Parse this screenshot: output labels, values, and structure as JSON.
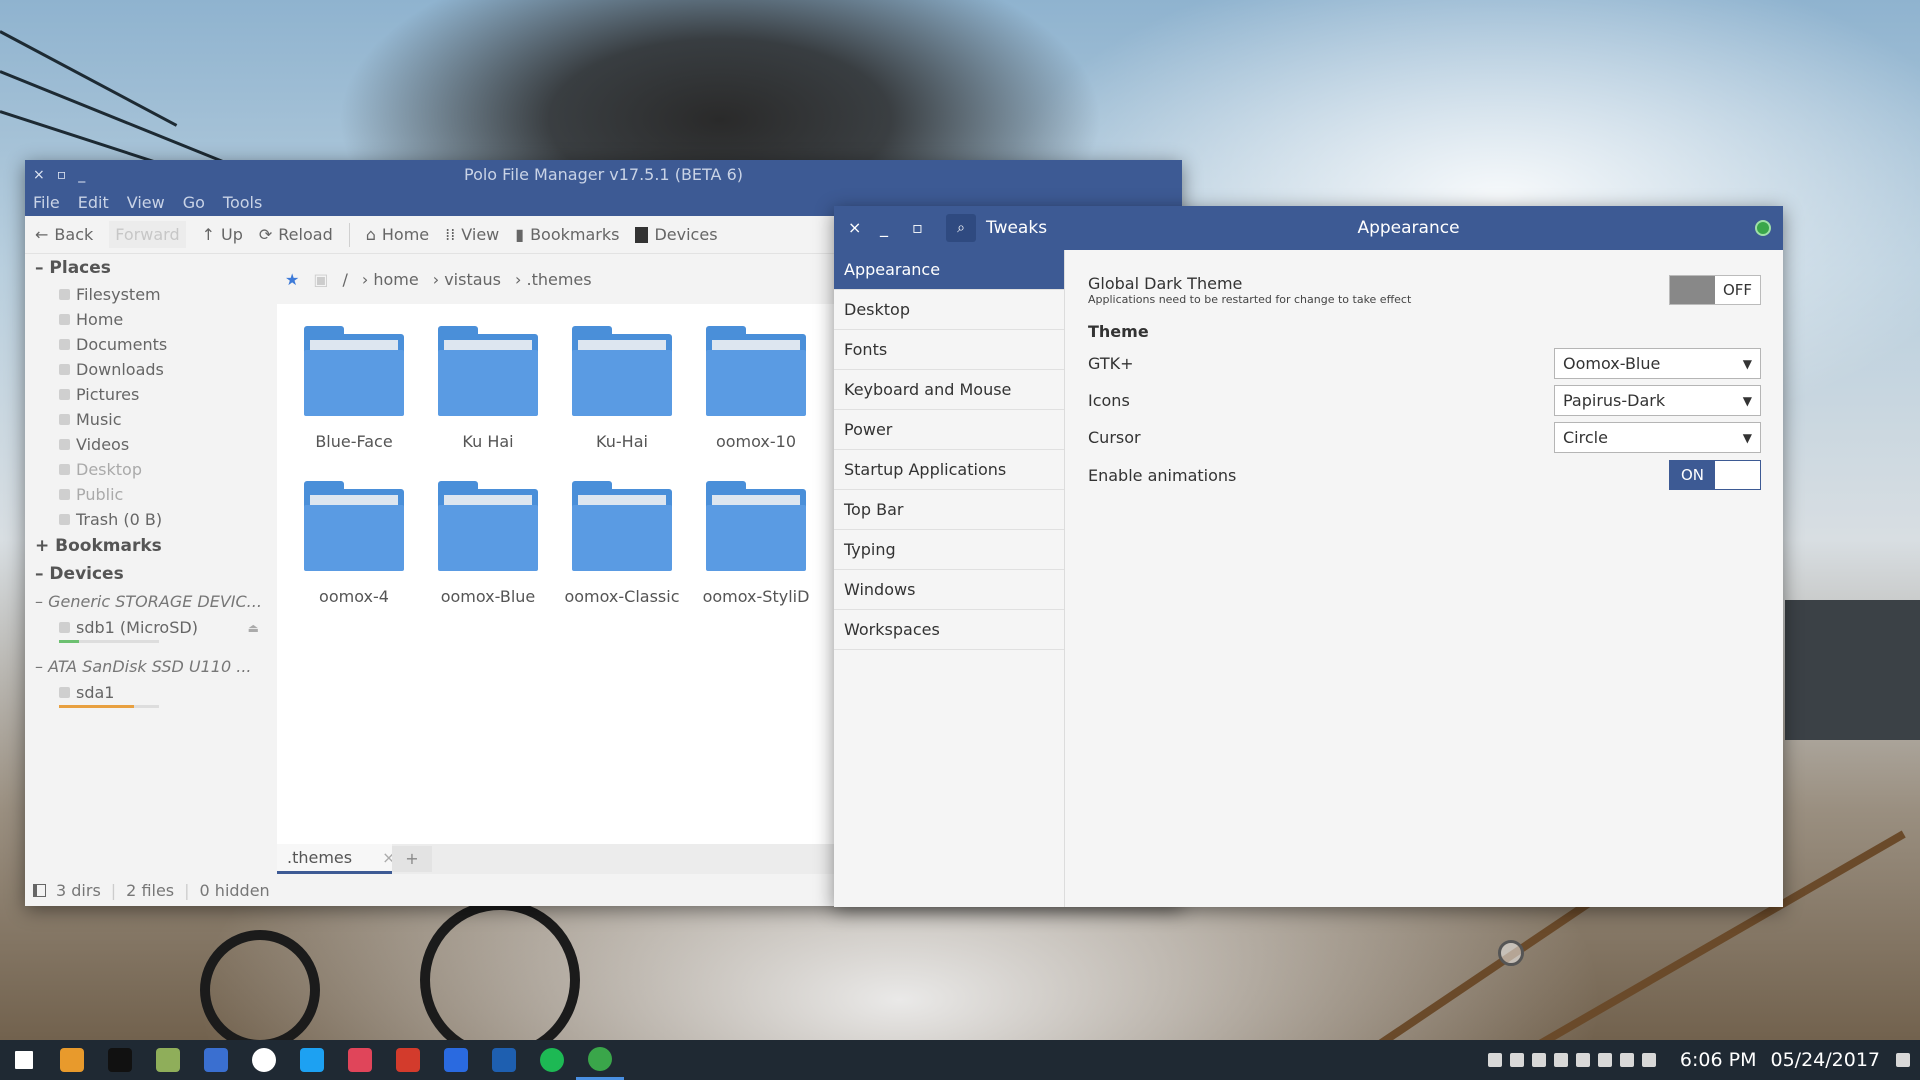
{
  "polo": {
    "title": "Polo File Manager v17.5.1 (BETA 6)",
    "window_buttons": [
      "×",
      "▫",
      "_"
    ],
    "menu": [
      "File",
      "Edit",
      "View",
      "Go",
      "Tools"
    ],
    "toolbar": {
      "back": "Back",
      "forward": "Forward",
      "up": "Up",
      "reload": "Reload",
      "home": "Home",
      "view": "View",
      "bookmarks": "Bookmarks",
      "devices": "Devices"
    },
    "sidebar": {
      "places_header": "Places",
      "places": [
        "Filesystem",
        "Home",
        "Documents",
        "Downloads",
        "Pictures",
        "Music",
        "Videos",
        "Desktop",
        "Public",
        "Trash (0 B)"
      ],
      "bookmarks_header": "Bookmarks",
      "devices_header": "Devices",
      "device1": "Generic STORAGE DEVIC...",
      "device1_part": "sdb1 (MicroSD)",
      "device1_usage": 0.2,
      "device2": "ATA SanDisk SSD U110 ...",
      "device2_part": "sda1",
      "device2_usage": 0.75
    },
    "breadcrumb": [
      "/",
      "home",
      "vistaus",
      ".themes"
    ],
    "items": [
      "Blue-Face",
      "Ku Hai",
      "Ku-Hai",
      "oomox-10",
      "oomox-4",
      "oomox-Blue",
      "oomox-Classic",
      "oomox-StyliD"
    ],
    "tab": {
      "label": ".themes",
      "close": "×",
      "add": "+"
    },
    "status": {
      "dirs": "3 dirs",
      "files": "2 files",
      "hidden": "0 hidden"
    }
  },
  "tweaks": {
    "app_title": "Tweaks",
    "page_title": "Appearance",
    "window_buttons": [
      "×",
      "_",
      "▫"
    ],
    "nav": [
      "Appearance",
      "Desktop",
      "Fonts",
      "Keyboard and Mouse",
      "Power",
      "Startup Applications",
      "Top Bar",
      "Typing",
      "Windows",
      "Workspaces"
    ],
    "global_dark_theme": {
      "label": "Global Dark Theme",
      "note": "Applications need to be restarted for change to take effect",
      "state": "OFF"
    },
    "theme_header": "Theme",
    "gtk": {
      "label": "GTK+",
      "value": "Oomox-Blue"
    },
    "icons": {
      "label": "Icons",
      "value": "Papirus-Dark"
    },
    "cursor": {
      "label": "Cursor",
      "value": "Circle"
    },
    "animations": {
      "label": "Enable animations",
      "state": "ON"
    }
  },
  "taskbar": {
    "time": "6:06 PM",
    "date": "05/24/2017",
    "apps": [
      "start-menu-icon",
      "download-manager-icon",
      "pling-icon",
      "file-manager-icon",
      "gimp-icon",
      "safari-icon",
      "twitter-icon",
      "image-viewer-icon",
      "vivaldi-icon",
      "writer-icon",
      "outlook-icon",
      "spotify-icon",
      "tweaks-icon"
    ],
    "app_colors": [
      "#ffffff",
      "#e89a2c",
      "#111111",
      "#8fae5a",
      "#3a6fd0",
      "#ffffff",
      "#1da1f2",
      "#e0455a",
      "#d33b2c",
      "#2a6ae0",
      "#1e5fb0",
      "#1db954",
      "#3aa64a"
    ]
  }
}
